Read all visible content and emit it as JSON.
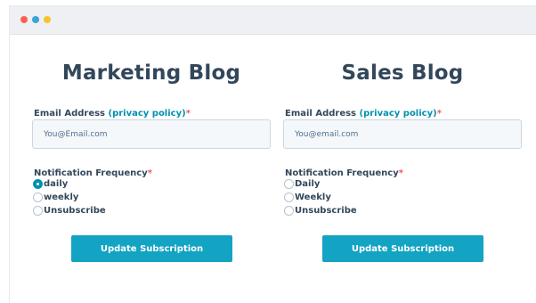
{
  "window": {
    "controls": [
      {
        "name": "close",
        "color": "#ff5f57"
      },
      {
        "name": "minimize",
        "color": "#3aa6d6"
      },
      {
        "name": "maximize",
        "color": "#f8c32c"
      }
    ]
  },
  "forms": [
    {
      "title": "Marketing Blog",
      "email_label": "Email Address ",
      "privacy_link": "(privacy policy)",
      "required_mark": "*",
      "email_placeholder": "You@Email.com",
      "email_value": "",
      "frequency_label": "Notification Frequency",
      "frequency_options": [
        {
          "label": "daily",
          "checked": true
        },
        {
          "label": "weekly",
          "checked": false
        },
        {
          "label": "Unsubscribe",
          "checked": false
        }
      ],
      "button_label": "Update Subscription"
    },
    {
      "title": "Sales Blog",
      "email_label": "Email Address ",
      "privacy_link": "(privacy policy)",
      "required_mark": "*",
      "email_placeholder": "You@email.com",
      "email_value": "",
      "frequency_label": "Notification Frequency",
      "frequency_options": [
        {
          "label": "Daily",
          "checked": false
        },
        {
          "label": "Weekly",
          "checked": false
        },
        {
          "label": "Unsubscribe",
          "checked": false
        }
      ],
      "button_label": "Update Subscription"
    }
  ],
  "colors": {
    "accent": "#0091ae",
    "button": "#13a3c3",
    "required": "#f2545b",
    "text": "#33475b"
  }
}
